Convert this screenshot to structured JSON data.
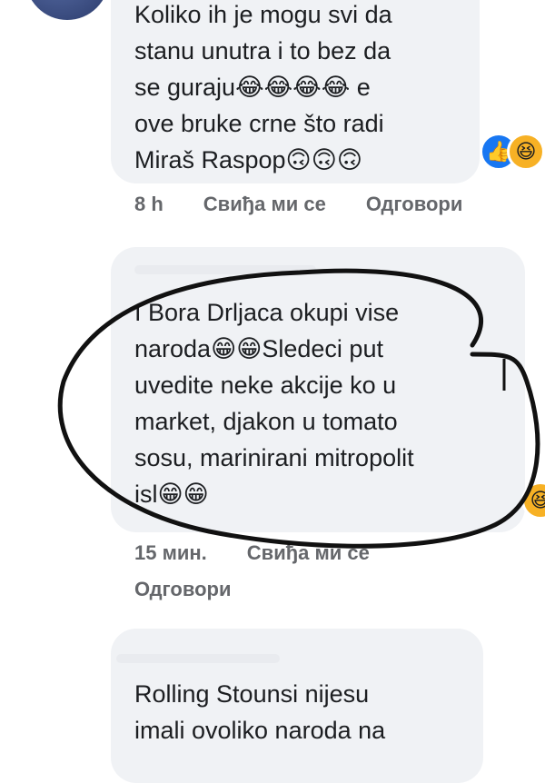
{
  "comment1": {
    "text": "Koliko ih je mogu svi da\nstanu unutra i to bez da\nse guraju😂😂😂😂 e\nove bruke crne što radi\nMiraš Raspop🙃🙃🙃",
    "time": "8 h",
    "like_label": "Свиђа ми се",
    "reply_label": "Одговори",
    "reactions": [
      "like-icon",
      "haha-icon"
    ]
  },
  "comment2": {
    "text": "I Bora Drljaca okupi vise\nnaroda😁😁Sledeci put\nuvedite neke akcije ko u\nmarket, djakon u tomato\nsosu, marinirani mitropolit\nisl😁😁",
    "time": "15 мин.",
    "like_label": "Свиђа ми се",
    "reply_label": "Одговори",
    "reactions": [
      "haha-icon"
    ]
  },
  "comment3": {
    "text": "Rolling Stounsi nijesu\nimali ovoliko naroda na"
  }
}
